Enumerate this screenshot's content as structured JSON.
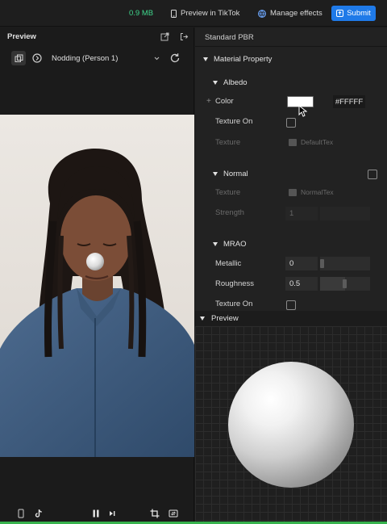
{
  "topbar": {
    "size": "0.9 MB",
    "preview_tiktok": "Preview in TikTok",
    "manage_effects": "Manage effects",
    "submit": "Submit"
  },
  "left_panel": {
    "title": "Preview",
    "animation": "Nodding (Person 1)"
  },
  "material": {
    "title": "Standard PBR",
    "material_property": "Material Property",
    "albedo": {
      "heading": "Albedo",
      "color_label": "Color",
      "color_hex": "#FFFFF",
      "color_value": "#ffffff",
      "texture_on_label": "Texture On",
      "texture_label": "Texture",
      "texture_value": "DefaultTex"
    },
    "normal": {
      "heading": "Normal",
      "texture_label": "Texture",
      "texture_value": "NormalTex",
      "strength_label": "Strength",
      "strength_value": "1"
    },
    "mrao": {
      "heading": "MRAO",
      "metallic_label": "Metallic",
      "metallic_value": "0",
      "roughness_label": "Roughness",
      "roughness_value": "0.5",
      "texture_on_label": "Texture On"
    },
    "preview_heading": "Preview"
  },
  "colors": {
    "accent": "#1f7ae8",
    "size_green": "#3fd68c"
  }
}
